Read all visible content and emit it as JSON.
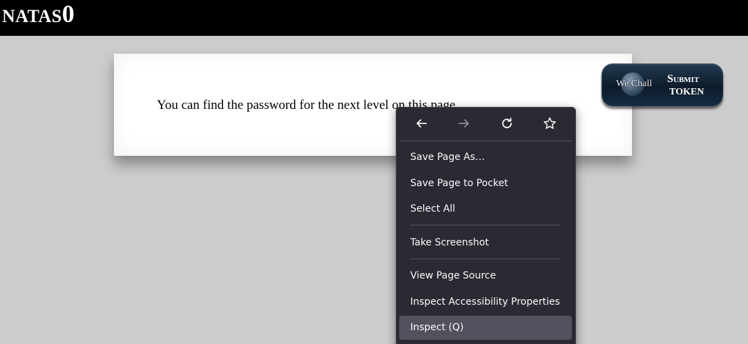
{
  "header": {
    "title_main": "NATAS",
    "title_number": "0"
  },
  "content": {
    "text": "You can find the password for the next level on this page."
  },
  "wechall": {
    "logo_text": "We Chall",
    "submit_label": "Submit",
    "token_label": "TOKEN"
  },
  "context_menu": {
    "nav_icons": [
      "back-arrow-icon",
      "forward-arrow-icon",
      "reload-icon",
      "bookmark-star-icon"
    ],
    "items": [
      {
        "label": "Save Page As…"
      },
      {
        "label": "Save Page to Pocket"
      },
      {
        "label": "Select All"
      },
      {
        "label": "Take Screenshot"
      },
      {
        "label": "View Page Source"
      },
      {
        "label": "Inspect Accessibility Properties"
      },
      {
        "label": "Inspect (Q)"
      }
    ],
    "hovered_item": "Inspect (Q)"
  },
  "colors": {
    "page_background": "#cccccc",
    "header_background": "#000000",
    "menu_background": "#2b2a33",
    "menu_hover": "#52525e",
    "menu_text": "#fbfbfe",
    "forward_disabled": "#8f8f9d"
  }
}
